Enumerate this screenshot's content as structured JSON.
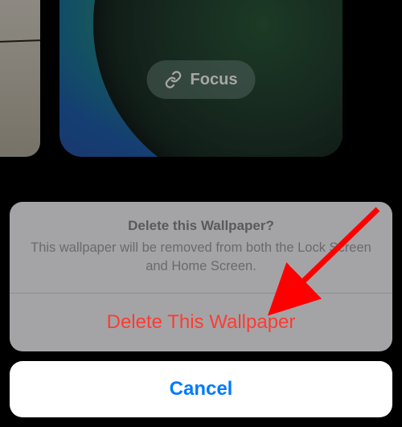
{
  "focus": {
    "label": "Focus"
  },
  "sheet": {
    "title": "Delete this Wallpaper?",
    "message": "This wallpaper will be removed from both the Lock Screen and Home Screen.",
    "destructive_label": "Delete This Wallpaper",
    "cancel_label": "Cancel"
  },
  "colors": {
    "destructive": "#ff3b30",
    "accent": "#007aff",
    "arrow": "#ff0000"
  }
}
